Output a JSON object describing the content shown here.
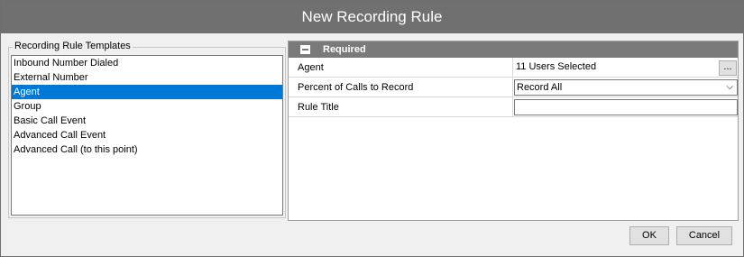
{
  "window": {
    "title": "New Recording Rule"
  },
  "templates": {
    "group_label": "Recording Rule Templates",
    "items": [
      {
        "label": "Inbound Number Dialed",
        "selected": false
      },
      {
        "label": "External Number",
        "selected": false
      },
      {
        "label": "Agent",
        "selected": true
      },
      {
        "label": "Group",
        "selected": false
      },
      {
        "label": "Basic Call Event",
        "selected": false
      },
      {
        "label": "Advanced Call Event",
        "selected": false
      },
      {
        "label": "Advanced Call (to this point)",
        "selected": false
      }
    ]
  },
  "properties": {
    "section_title": "Required",
    "rows": {
      "agent": {
        "label": "Agent",
        "value": "11 Users Selected",
        "button": "..."
      },
      "percent": {
        "label": "Percent of Calls to Record",
        "value": "Record All",
        "chevron": "⌵"
      },
      "title": {
        "label": "Rule Title",
        "value": ""
      }
    }
  },
  "buttons": {
    "ok": "OK",
    "cancel": "Cancel"
  },
  "colors": {
    "titlebar": "#707070",
    "selection": "#0078d7",
    "grid_header": "#7a7a7a"
  }
}
